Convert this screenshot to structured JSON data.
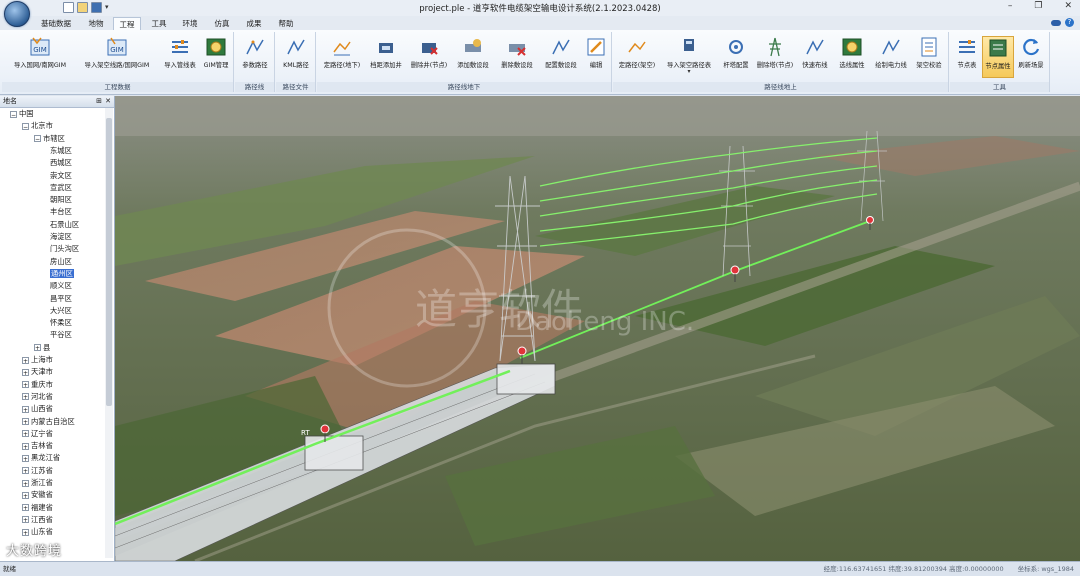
{
  "app": {
    "window_title": "project.ple - 道亨软件电缆架空输电设计系统(2.1.2023.0428)"
  },
  "ribbon_tabs": [
    "基础数据",
    "地物",
    "工程",
    "工具",
    "环境",
    "仿真",
    "成果",
    "帮助"
  ],
  "ribbon": {
    "groups": [
      {
        "label": "工程数据",
        "buttons": [
          "导入国网/南网GIM",
          "导入架空线路/国网GIM",
          "导入管线表",
          "GIM管理"
        ]
      },
      {
        "label": "路径线",
        "buttons": [
          "参数路径"
        ]
      },
      {
        "label": "路径文件",
        "buttons": [
          "KML路径"
        ]
      },
      {
        "label": "路径线地下",
        "buttons": [
          "定路径(地下)",
          "档距添加井",
          "删除井(节点)",
          "添加敷设段",
          "删除敷设段",
          "配置敷设段",
          "编辑"
        ]
      },
      {
        "label": "路径线地上",
        "buttons": [
          "定路径(架空)",
          "导入架空路径表",
          "杆塔配置",
          "删除塔(节点)",
          "快速布线",
          "选线属性",
          "绘制电力线",
          "架空校验"
        ]
      },
      {
        "label": "工具",
        "buttons": [
          "节点表",
          "节点属性",
          "刷新场景"
        ]
      }
    ]
  },
  "panel": {
    "title": "地名",
    "tree": [
      {
        "label": "中国",
        "level": 0,
        "expanded": true
      },
      {
        "label": "北京市",
        "level": 1,
        "expanded": true
      },
      {
        "label": "市辖区",
        "level": 2,
        "expanded": true
      },
      {
        "label": "东城区",
        "level": 3
      },
      {
        "label": "西城区",
        "level": 3
      },
      {
        "label": "崇文区",
        "level": 3
      },
      {
        "label": "宣武区",
        "level": 3
      },
      {
        "label": "朝阳区",
        "level": 3
      },
      {
        "label": "丰台区",
        "level": 3
      },
      {
        "label": "石景山区",
        "level": 3
      },
      {
        "label": "海淀区",
        "level": 3
      },
      {
        "label": "门头沟区",
        "level": 3
      },
      {
        "label": "房山区",
        "level": 3
      },
      {
        "label": "通州区",
        "level": 3,
        "selected": true
      },
      {
        "label": "顺义区",
        "level": 3
      },
      {
        "label": "昌平区",
        "level": 3
      },
      {
        "label": "大兴区",
        "level": 3
      },
      {
        "label": "怀柔区",
        "level": 3
      },
      {
        "label": "平谷区",
        "level": 3
      },
      {
        "label": "县",
        "level": 2,
        "expanded": false
      },
      {
        "label": "上海市",
        "level": 1,
        "expanded": false
      },
      {
        "label": "天津市",
        "level": 1,
        "expanded": false
      },
      {
        "label": "重庆市",
        "level": 1,
        "expanded": false
      },
      {
        "label": "河北省",
        "level": 1,
        "expanded": false
      },
      {
        "label": "山西省",
        "level": 1,
        "expanded": false
      },
      {
        "label": "内蒙古自治区",
        "level": 1,
        "expanded": false
      },
      {
        "label": "辽宁省",
        "level": 1,
        "expanded": false
      },
      {
        "label": "吉林省",
        "level": 1,
        "expanded": false
      },
      {
        "label": "黑龙江省",
        "level": 1,
        "expanded": false
      },
      {
        "label": "江苏省",
        "level": 1,
        "expanded": false
      },
      {
        "label": "浙江省",
        "level": 1,
        "expanded": false
      },
      {
        "label": "安徽省",
        "level": 1,
        "expanded": false
      },
      {
        "label": "福建省",
        "level": 1,
        "expanded": false
      },
      {
        "label": "江西省",
        "level": 1,
        "expanded": false
      },
      {
        "label": "山东省",
        "level": 1,
        "expanded": false
      }
    ]
  },
  "scene": {
    "watermark_en": "Daoheng INC.",
    "watermark_cn": "道亨软件",
    "node_label": "RT"
  },
  "status": {
    "left": "就绪",
    "coords": "经度:116.63741651 纬度:39.81200394 高度:0.00000000",
    "extra": "坐标系: wgs_1984"
  },
  "corner_brand": "大数跨境",
  "colors": {
    "accent": "#3a6fd1",
    "route_green": "#72f05a",
    "marker_red": "#e0343a",
    "ribbon_bg": "#eef3f9"
  }
}
